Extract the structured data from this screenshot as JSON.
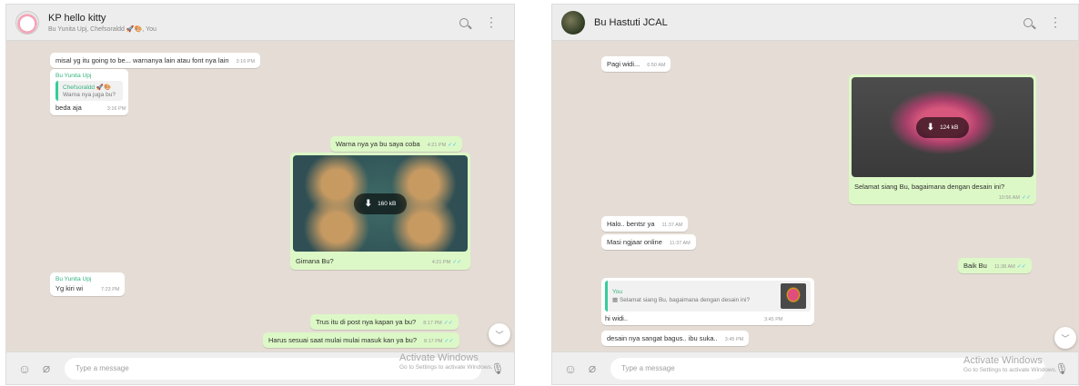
{
  "left": {
    "header": {
      "title": "KP hello kitty",
      "subtitle": "Bu Yunita Upj, Chefsoraldd 🚀🎨, You"
    },
    "messages": [
      {
        "text": "misal yg itu going to be... warnanya lain atau font nya lain",
        "time": "3:16 PM"
      },
      {
        "sender": "Bu Yunita Upj",
        "quote_name": "Chefsoraldd 🚀🎨",
        "quote_text": "Warna nya juga bu?",
        "text": "beda aja",
        "time": "3:16 PM"
      },
      {
        "text": "Warna nya ya bu saya coba",
        "time": "4:21 PM"
      },
      {
        "media_size": "160 kB",
        "caption": "Gimana Bu?",
        "time": "4:21 PM"
      },
      {
        "sender": "Bu Yunita Upj",
        "text": "Yg kiri wi",
        "time": "7:23 PM"
      },
      {
        "text": "Trus itu di post nya kapan ya bu?",
        "time": "8:17 PM"
      },
      {
        "text": "Harus sesuai saat mulai mulai masuk kan ya bu?",
        "time": "8:17 PM"
      }
    ],
    "input_placeholder": "Type a message"
  },
  "right": {
    "header": {
      "title": "Bu Hastuti JCAL"
    },
    "messages": [
      {
        "text": "Pagi widi...",
        "time": "6:50 AM"
      },
      {
        "media_size": "124 kB",
        "caption": "Selamat siang Bu, bagaimana dengan desain ini?",
        "time": "10:56 AM"
      },
      {
        "text": "Halo.. bentsr ya",
        "time": "11:37 AM"
      },
      {
        "text": "Masi ngjaar online",
        "time": "11:37 AM"
      },
      {
        "text": "Baik Bu",
        "time": "11:38 AM"
      },
      {
        "quote_name": "You",
        "quote_text": "Selamat siang Bu, bagaimana dengan desain ini?",
        "text": "hi widi..",
        "time": "3:45 PM"
      },
      {
        "text": "desain nya sangat bagus.. ibu suka..",
        "time": "3:45 PM"
      }
    ],
    "input_placeholder": "Type a message"
  },
  "watermark": {
    "title": "Activate Windows",
    "subtitle": "Go to Settings to activate Windows."
  },
  "colors": {
    "incoming": "#ffffff",
    "outgoing": "#dcf8c6",
    "chat_bg": "#e5ddd5",
    "sender_name": "#35b37e",
    "read_tick": "#4fc3f7"
  },
  "icons": [
    "search-icon",
    "menu-icon",
    "emoji-icon",
    "attach-icon",
    "mic-icon",
    "download-icon",
    "double-check-icon",
    "chevron-down-icon"
  ]
}
